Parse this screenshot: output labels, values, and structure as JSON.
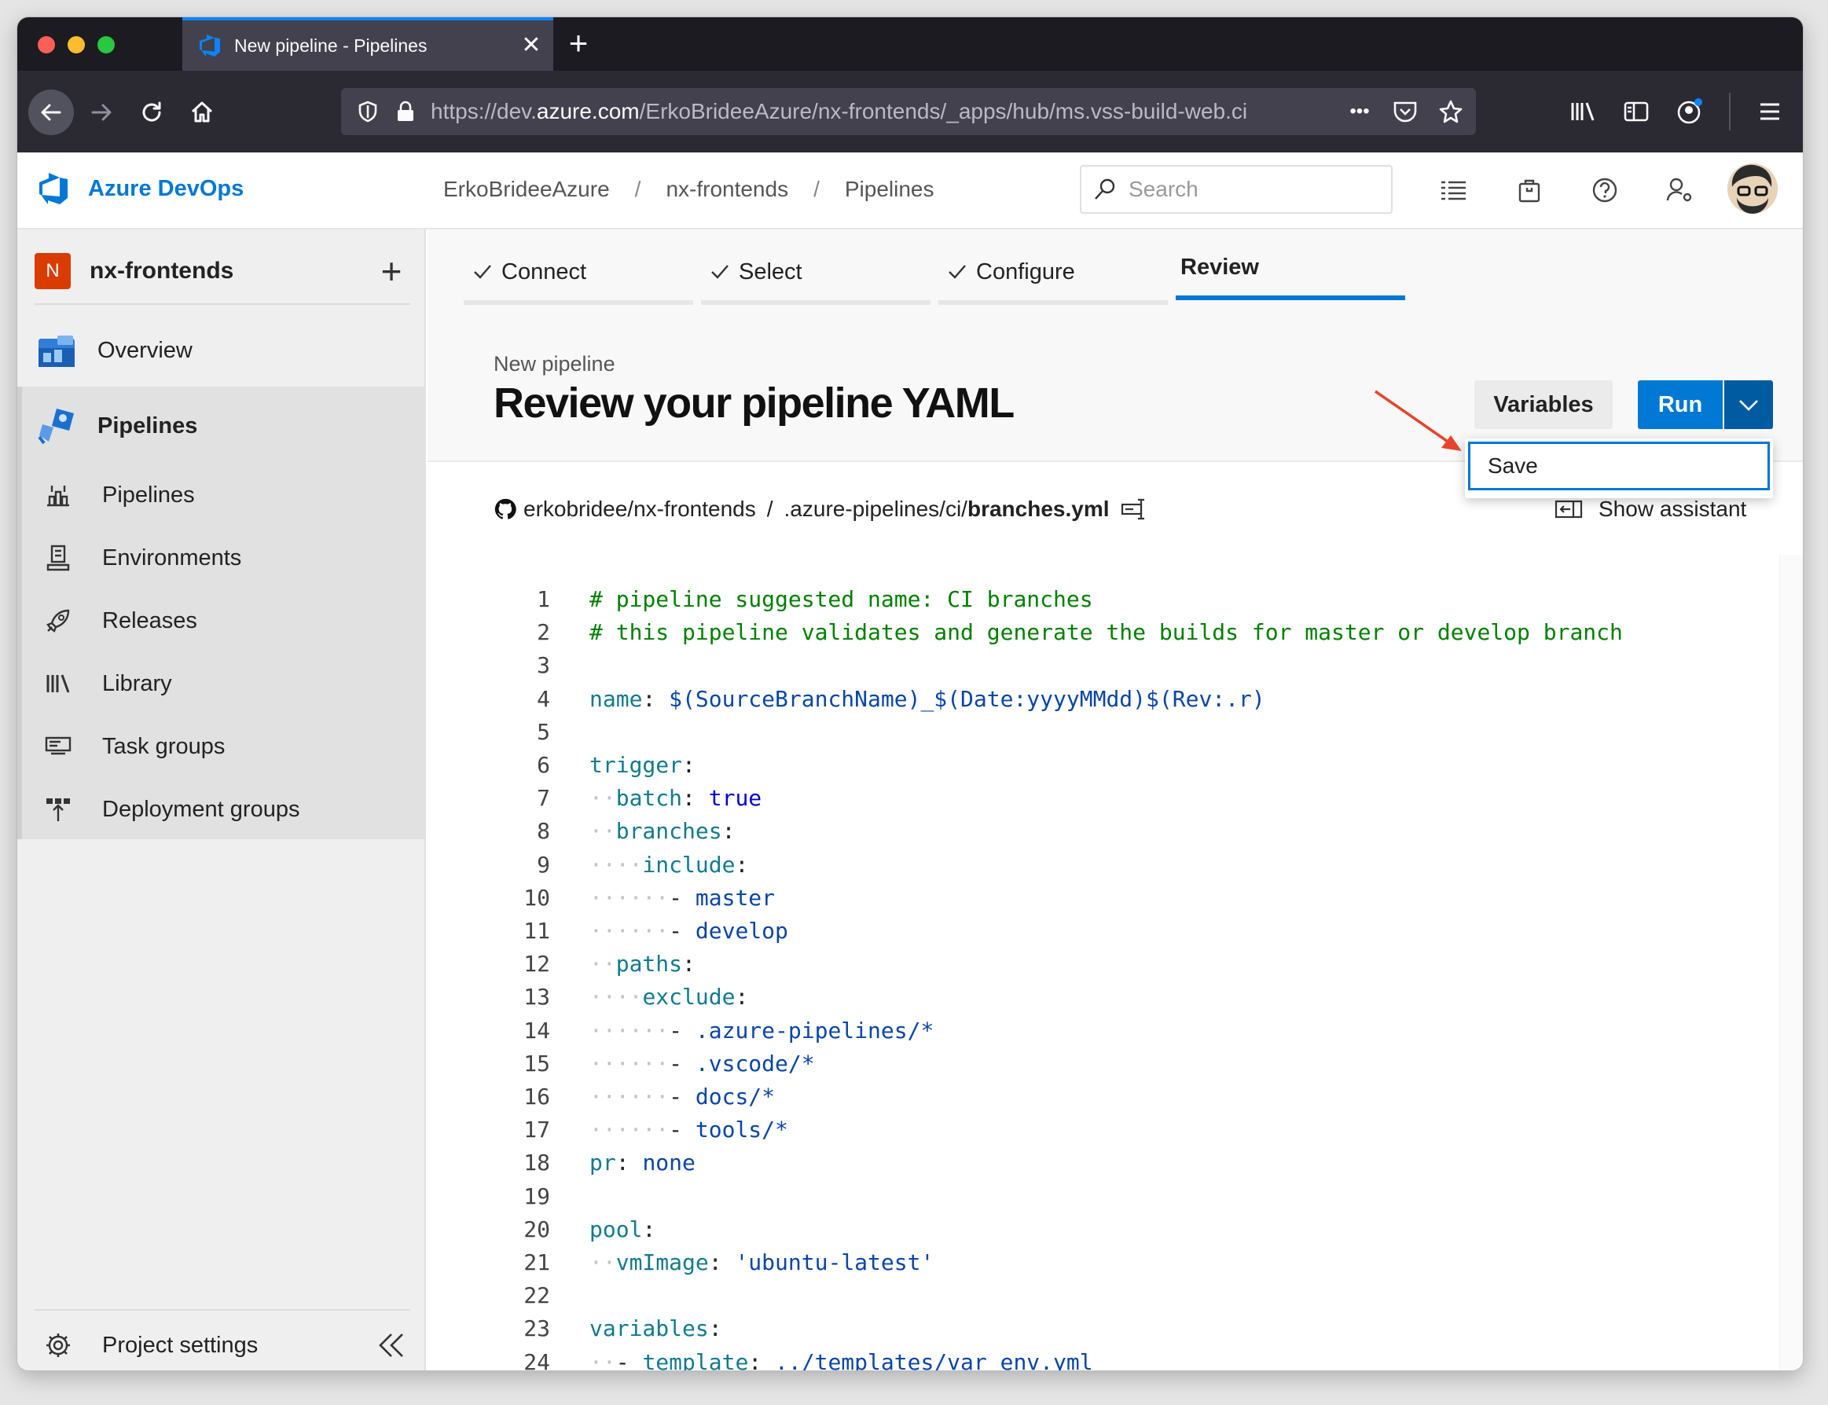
{
  "browser": {
    "tab_title": "New pipeline - Pipelines",
    "tab_close": "✕",
    "new_tab": "+",
    "url_prefix": "https://dev.",
    "url_host": "azure.com",
    "url_rest": "/ErkoBrideeAzure/nx-frontends/_apps/hub/ms.vss-build-web.ci",
    "url_more": "•••"
  },
  "header": {
    "brand": "Azure DevOps",
    "breadcrumb": [
      "ErkoBrideeAzure",
      "nx-frontends",
      "Pipelines"
    ],
    "breadcrumb_sep": "/",
    "search_placeholder": "Search"
  },
  "sidebar": {
    "project_initial": "N",
    "project_name": "nx-frontends",
    "add_label": "+",
    "items": [
      {
        "label": "Overview",
        "icon": "overview-icon"
      },
      {
        "label": "Pipelines",
        "icon": "pipelines-icon"
      }
    ],
    "sub_items": [
      {
        "label": "Pipelines",
        "icon": "pipelines-list-icon"
      },
      {
        "label": "Environments",
        "icon": "environments-icon"
      },
      {
        "label": "Releases",
        "icon": "releases-icon"
      },
      {
        "label": "Library",
        "icon": "library-icon"
      },
      {
        "label": "Task groups",
        "icon": "task-groups-icon"
      },
      {
        "label": "Deployment groups",
        "icon": "deployment-groups-icon"
      }
    ],
    "settings_label": "Project settings"
  },
  "wizard": {
    "steps": [
      {
        "label": "Connect",
        "done": true
      },
      {
        "label": "Select",
        "done": true
      },
      {
        "label": "Configure",
        "done": true
      },
      {
        "label": "Review",
        "done": false,
        "active": true
      }
    ]
  },
  "page": {
    "subtitle": "New pipeline",
    "title": "Review your pipeline YAML",
    "variables_label": "Variables",
    "run_label": "Run",
    "menu_save_label": "Save",
    "repo": "erkobridee/nx-frontends",
    "path_sep": "/",
    "file_dir": ".azure-pipelines/ci/",
    "file_name": "branches.yml",
    "show_assistant_label": "Show assistant"
  },
  "code_lines": [
    "# pipeline suggested name: CI branches",
    "# this pipeline validates and generate the builds for master or develop branch",
    "",
    "name: $(SourceBranchName)_$(Date:yyyyMMdd)$(Rev:.r)",
    "",
    "trigger:",
    "  batch: true",
    "  branches:",
    "    include:",
    "      - master",
    "      - develop",
    "  paths:",
    "    exclude:",
    "      - .azure-pipelines/*",
    "      - .vscode/*",
    "      - docs/*",
    "      - tools/*",
    "pr: none",
    "",
    "pool:",
    "  vmImage: 'ubuntu-latest'",
    "",
    "variables:",
    "  - template: ../templates/var_env.yml",
    ""
  ],
  "colors": {
    "accent": "#0078d4",
    "comment": "#008000",
    "key": "#127a8f",
    "value": "#0a45a8",
    "project_badge": "#da3b01"
  }
}
